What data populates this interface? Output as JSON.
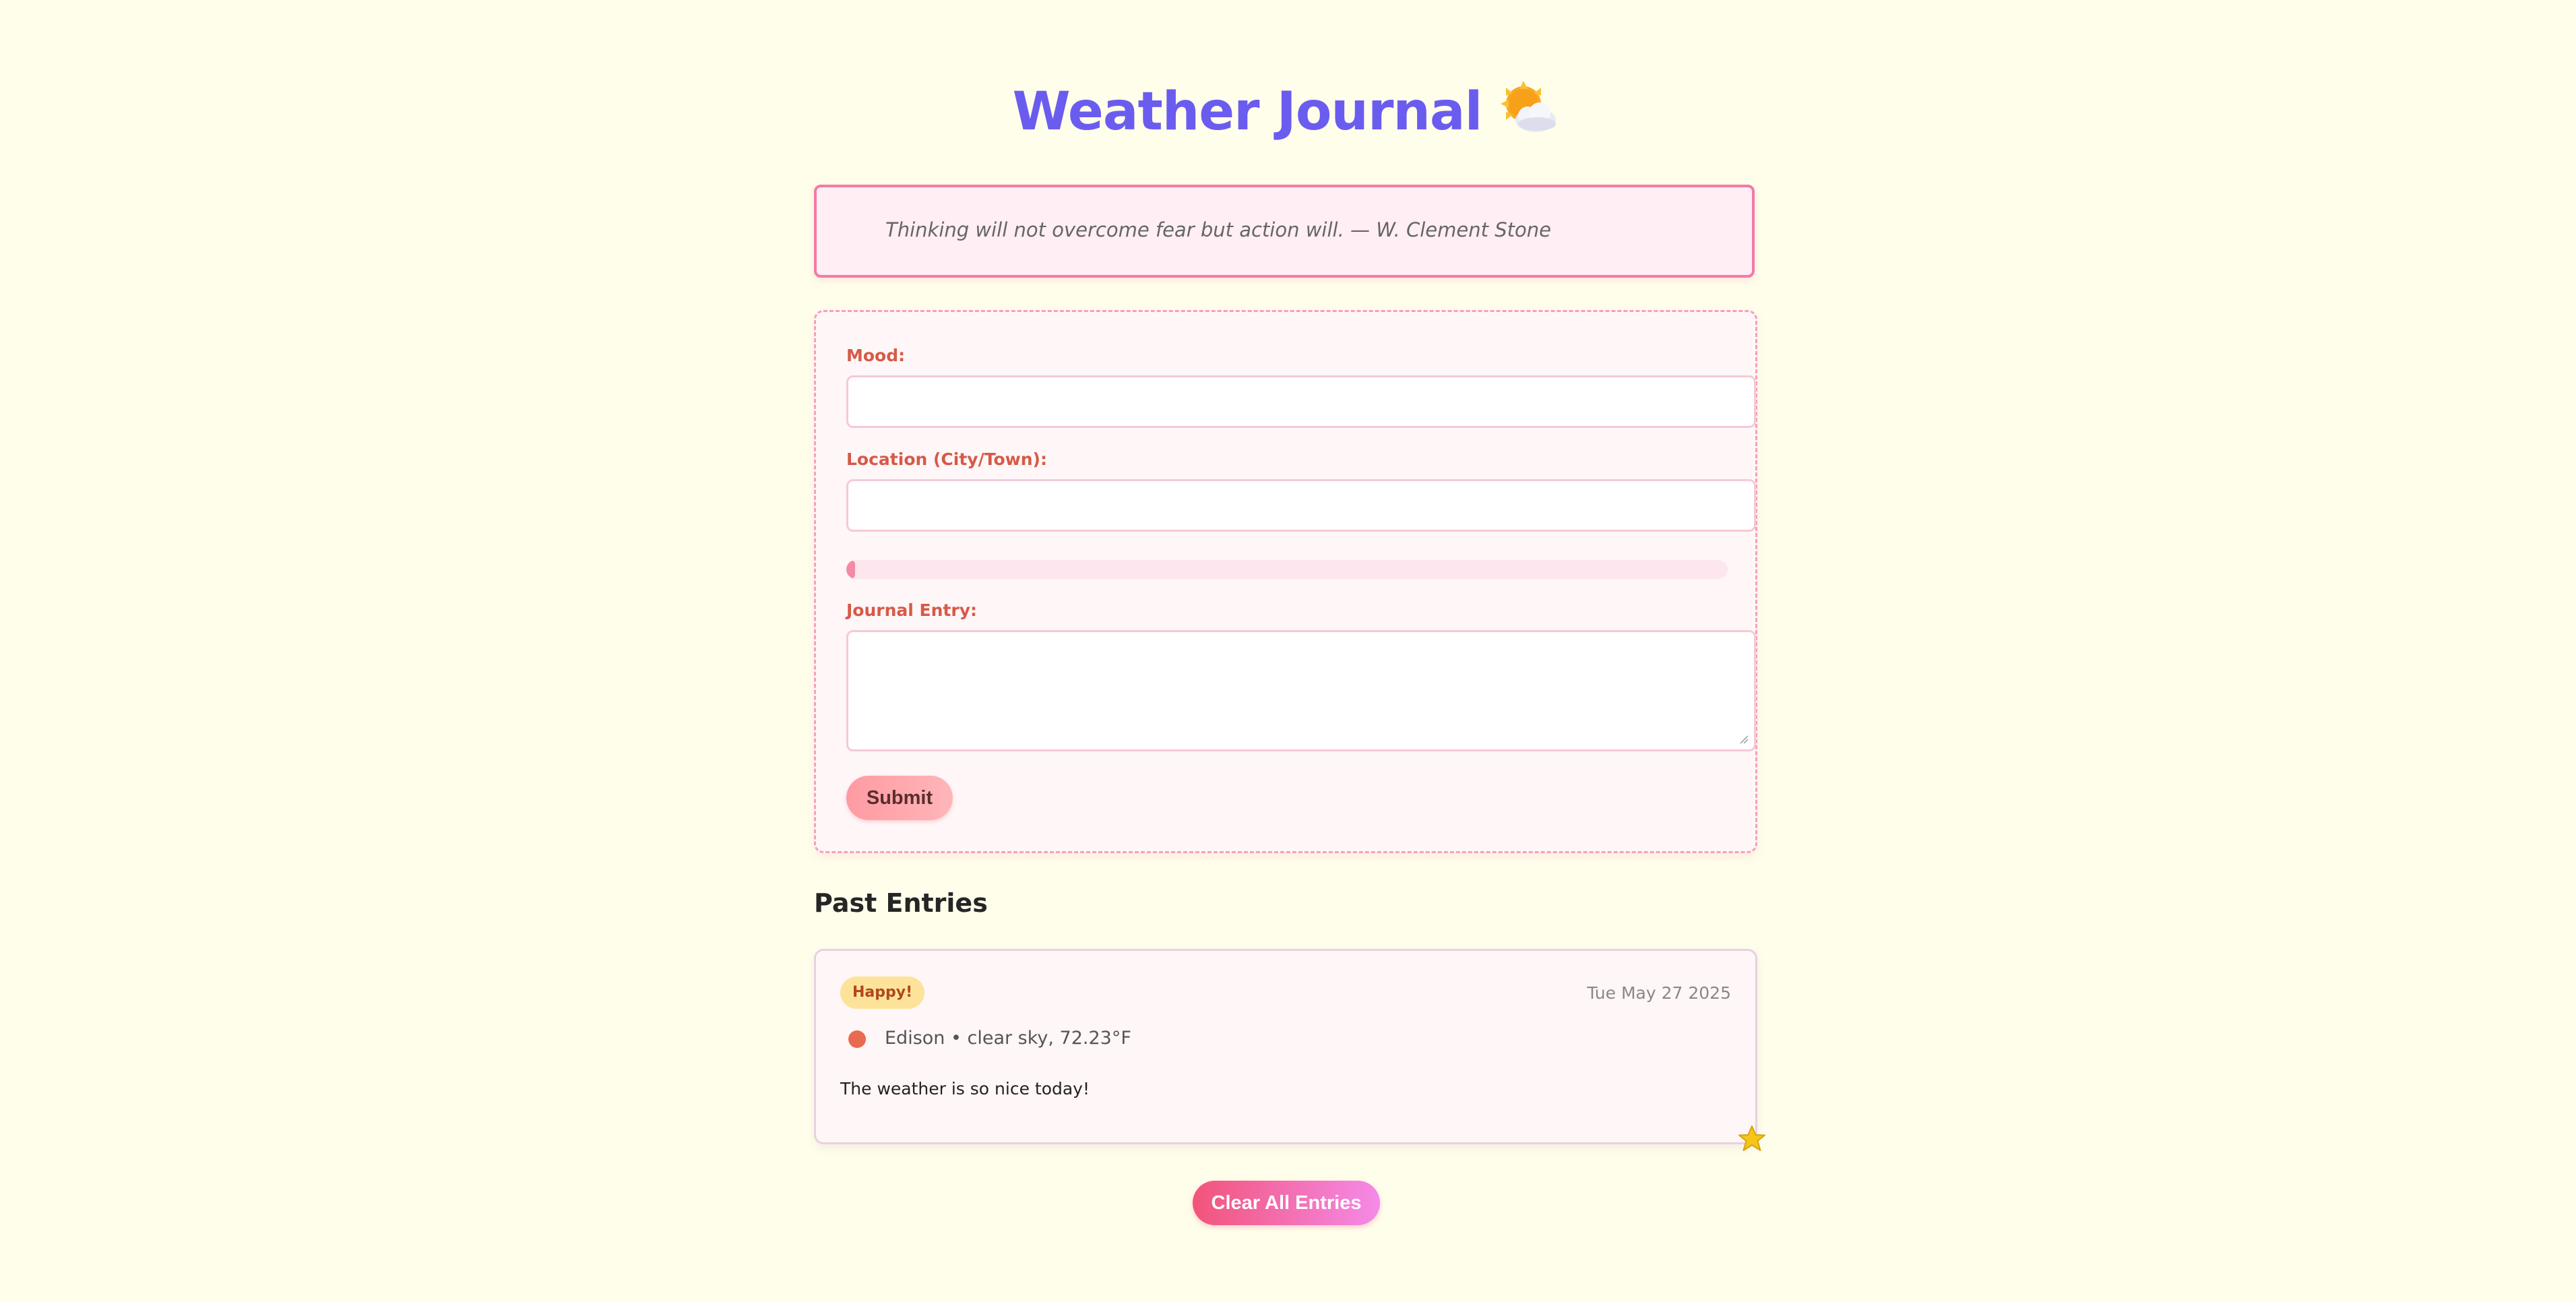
{
  "header": {
    "title": "Weather Journal",
    "emoji_icon": "sun-behind-cloud-icon"
  },
  "quote": {
    "text": "Thinking will not overcome fear but action will. — W. Clement Stone"
  },
  "form": {
    "mood_label": "Mood:",
    "mood_value": "",
    "location_label": "Location (City/Town):",
    "location_value": "",
    "progress_fraction": 0.01,
    "journal_label": "Journal Entry:",
    "journal_value": "",
    "submit_label": "Submit"
  },
  "past_entries": {
    "heading": "Past Entries",
    "entries": [
      {
        "mood": "Happy!",
        "date": "Tue May 27 2025",
        "weather": "Edison • clear sky, 72.23°F",
        "text": "The weather is so nice today!"
      }
    ]
  },
  "clear_button_label": "Clear All Entries",
  "colors": {
    "background": "#fffeeb",
    "title": "#6b5cf0",
    "accent_pink": "#f47aa6",
    "label": "#d65a47"
  }
}
